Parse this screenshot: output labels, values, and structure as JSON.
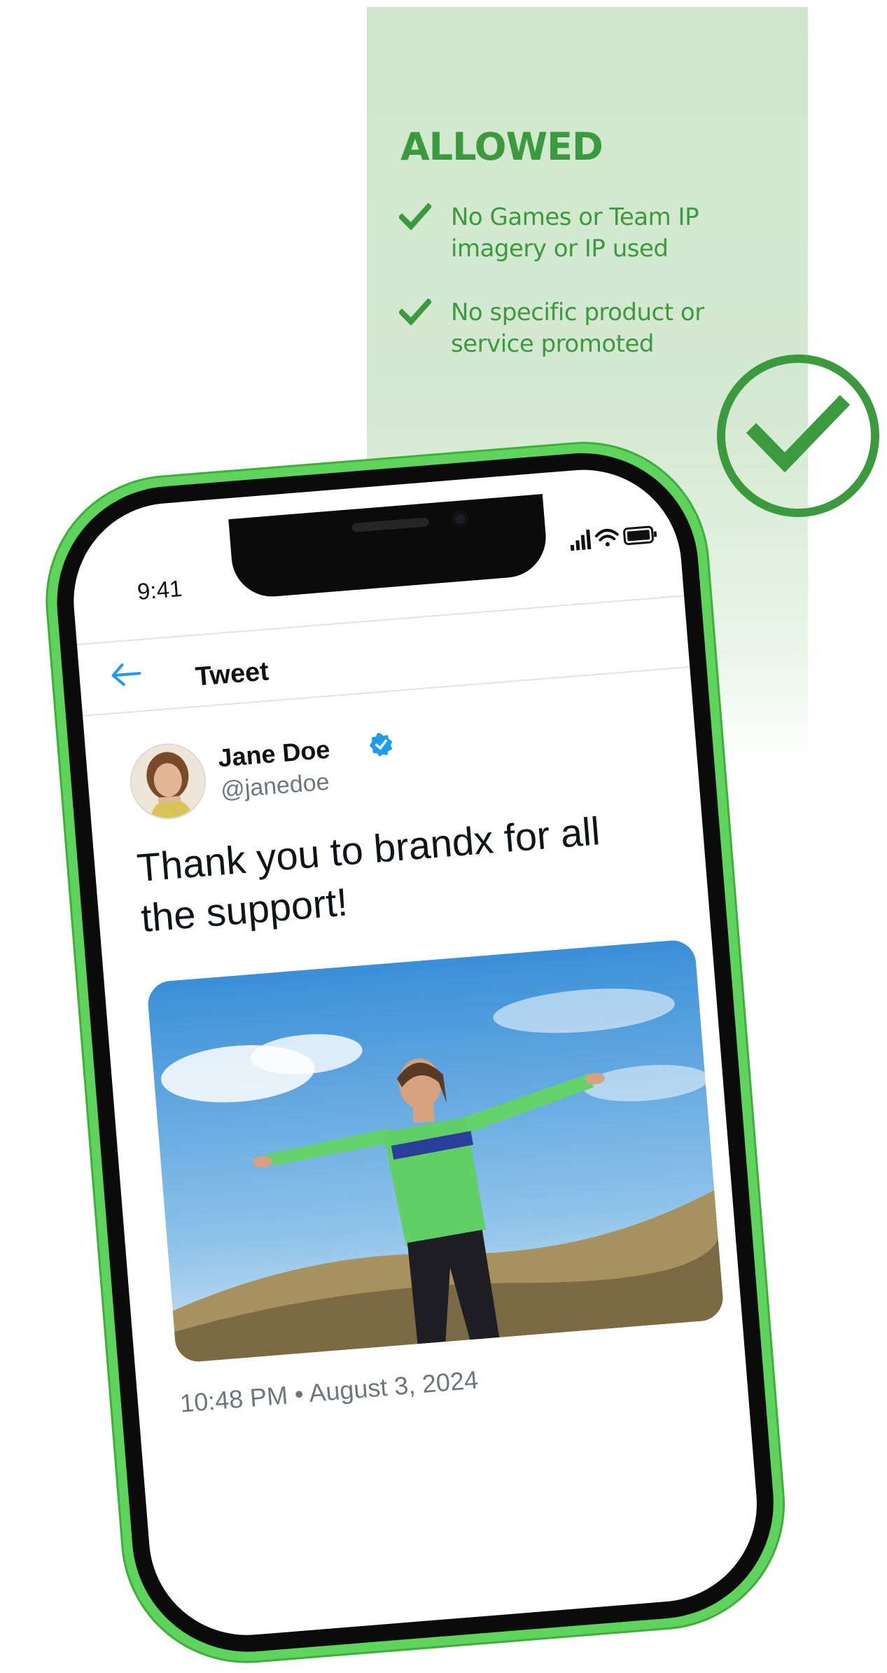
{
  "panel": {
    "title": "ALLOWED",
    "rules": [
      {
        "text": "No Games or Team IP imagery or IP used",
        "icon": "check-icon"
      },
      {
        "text": "No specific product or service promoted",
        "icon": "check-icon"
      }
    ],
    "badge_icon": "circle-check-icon",
    "accent_color": "#3c9a3e"
  },
  "phone": {
    "frame_color": "#5fd45c",
    "status_bar": {
      "time": "9:41",
      "icons": [
        "signal-icon",
        "wifi-icon",
        "battery-icon"
      ]
    },
    "header": {
      "title": "Tweet",
      "back_icon": "back-arrow-icon"
    },
    "tweet": {
      "author_name": "Jane Doe",
      "author_handle": "@janedoe",
      "verified": true,
      "text": "Thank you to brandx for all the support!",
      "media_alt": "woman in green jacket with arms outstretched on a hilltop under blue sky",
      "timestamp": "10:48 PM • August 3, 2024"
    }
  }
}
